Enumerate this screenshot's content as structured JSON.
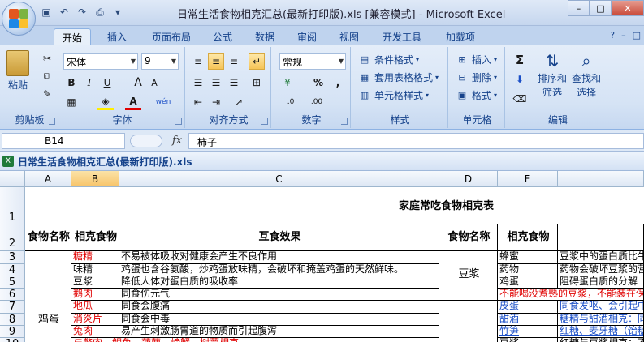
{
  "window": {
    "title": "日常生活食物相克汇总(最新打印版).xls  [兼容模式] - Microsoft Excel",
    "min": "–",
    "max": "□",
    "close": "✕"
  },
  "ribbon_tabs": [
    "开始",
    "插入",
    "页面布局",
    "公式",
    "数据",
    "审阅",
    "视图",
    "开发工具",
    "加载项"
  ],
  "help": "?",
  "ribbon": {
    "clipboard": {
      "label": "剪贴板",
      "paste": "粘贴"
    },
    "font": {
      "label": "字体",
      "name": "宋体",
      "size": "9",
      "bold": "B",
      "italic": "I",
      "underline": "U",
      "grow": "A",
      "shrink": "A",
      "color": "A",
      "wen": "wén"
    },
    "alignment": {
      "label": "对齐方式"
    },
    "number": {
      "label": "数字",
      "format": "常规",
      "percent": "%",
      "comma": ",",
      "inc": ".0",
      "dec": ".00"
    },
    "styles": {
      "label": "样式",
      "conditional": "条件格式",
      "table": "套用表格格式",
      "cell": "单元格样式"
    },
    "cells": {
      "label": "单元格",
      "insert": "插入",
      "delete": "删除",
      "format": "格式"
    },
    "editing": {
      "label": "编辑",
      "sum": "Σ",
      "sort1": "排序和",
      "sort2": "筛选",
      "find1": "查找和",
      "find2": "选择"
    }
  },
  "formula_bar": {
    "cell_ref": "B14",
    "fx": "fx",
    "content": "柿子"
  },
  "workbook_title": "日常生活食物相克汇总(最新打印版).xls",
  "columns": [
    "A",
    "B",
    "C",
    "D",
    "E"
  ],
  "rows": [
    "1",
    "2",
    "3",
    "4",
    "5",
    "6",
    "7",
    "8",
    "9",
    "10"
  ],
  "sheet": {
    "title": "家庭常吃食物相克表",
    "headers": {
      "a": "食物名称",
      "b": "相克食物",
      "c": "互食效果",
      "d": "食物名称",
      "e": "相克食物"
    },
    "left_group_name": "鸡蛋",
    "right_group_name": "豆浆",
    "left_rows": [
      {
        "b": "糖精",
        "c": "不易被体吸收对健康会产生不良作用",
        "b_red": true,
        "c_red": false
      },
      {
        "b": "味精",
        "c": "鸡蛋也含谷氨酸，炒鸡蛋放味精，会破坏和掩盖鸡蛋的天然鲜味。",
        "b_red": false,
        "c_red": false
      },
      {
        "b": "豆浆",
        "c": "降低人体对蛋白质的吸收率",
        "b_red": false,
        "c_red": false
      },
      {
        "b": "鹅肉",
        "c": "同食伤元气",
        "b_red": true,
        "c_red": false
      },
      {
        "b": "地瓜",
        "c": "同食会腹痛",
        "b_red": true,
        "c_red": false
      },
      {
        "b": "消炎片",
        "c": "同食会中毒",
        "b_red": true,
        "c_red": false
      },
      {
        "b": "兔肉",
        "c": "易产生刺激肠胃道的物质而引起腹泻",
        "b_red": true,
        "c_red": false
      },
      {
        "b": "与鳖肉、鲤鱼、菠萝、螃蟹、树薯相克",
        "c": "",
        "b_red": true,
        "c_red": false
      }
    ],
    "right_rows": [
      {
        "e": "蜂蜜",
        "f": "豆浆中的蛋白质比牛",
        "style": "normal"
      },
      {
        "e": "药物",
        "f": "药物会破坏豆浆的营",
        "style": "normal"
      },
      {
        "e": "鸡蛋",
        "f": "阻碍蛋白质的分解",
        "style": "normal"
      },
      {
        "e": "不能喝没煮熟的豆浆，不能装在保",
        "f": "",
        "style": "red"
      },
      {
        "e": "皮蛋",
        "f": "同食发呕、会引起中",
        "style": "blue"
      },
      {
        "e": "甜酒",
        "f": "糖精与甜酒相克：同",
        "style": "blue"
      },
      {
        "e": "竹笋",
        "f": "红糖、麦牙糖（饴糖",
        "style": "blue"
      },
      {
        "e": "豆浆",
        "f": "红糖与豆浆相克：不",
        "style": "normal"
      }
    ]
  },
  "colors": {
    "accent": "#15428b",
    "red": "#e00000",
    "blue": "#1b4fc7"
  }
}
